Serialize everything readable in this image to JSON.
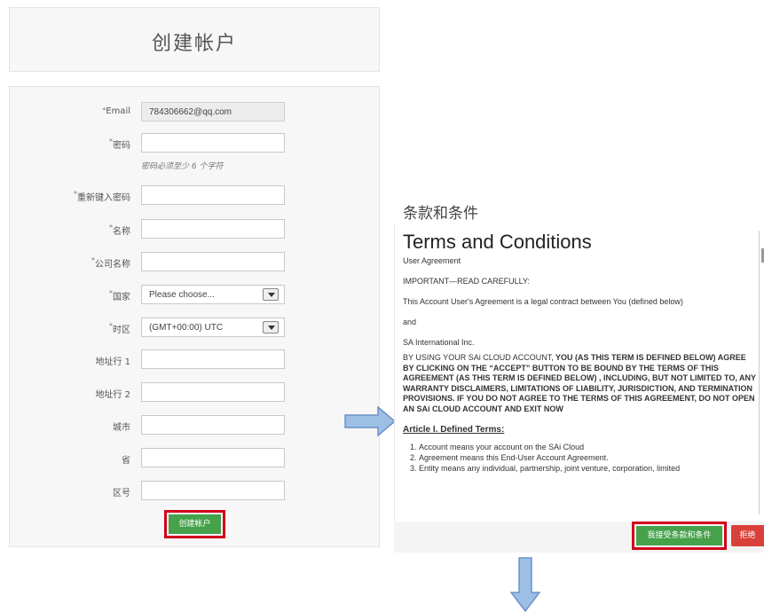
{
  "create_account": {
    "title": "创建帐户",
    "fields": [
      {
        "label": "Email",
        "value": "784306662@qq.com",
        "placeholder": ""
      },
      {
        "label": "密码",
        "value": "",
        "placeholder": ""
      },
      {
        "label": "重新键入密码",
        "value": "",
        "placeholder": ""
      },
      {
        "label": "名称",
        "value": "",
        "placeholder": ""
      },
      {
        "label": "公司名称",
        "value": "",
        "placeholder": ""
      },
      {
        "label": "国家",
        "value": "Please choose..."
      },
      {
        "label": "时区",
        "value": "(GMT+00:00) UTC"
      },
      {
        "label": "地址行 1",
        "value": ""
      },
      {
        "label": "地址行 2",
        "value": ""
      },
      {
        "label": "城市",
        "value": ""
      },
      {
        "label": "省",
        "value": ""
      },
      {
        "label": "区号",
        "value": ""
      }
    ],
    "required_mark": "*",
    "password_hint": "密码必须至少 6 个字符",
    "submit_label": "创建帐户"
  },
  "terms": {
    "heading": "条款和条件",
    "title": "Terms and Conditions",
    "p1": "User Agreement",
    "p2": "IMPORTANT—READ CAREFULLY:",
    "p3": "This Account User's Agreement is a legal contract between You (defined below)",
    "p4": "and",
    "p5": "SA International Inc.",
    "p6_lead": "BY USING YOUR SAi CLOUD ACCOUNT,",
    "p6_rest": " YOU (AS THIS TERM IS DEFINED BELOW) AGREE BY CLICKING ON THE “ACCEPT” BUTTON TO BE BOUND BY THE TERMS OF THIS AGREEMENT (AS THIS TERM IS DEFINED BELOW) , INCLUDING, BUT NOT LIMITED TO, ANY WARRANTY DISCLAIMERS, LIMITATIONS OF LIABILITY, JURISDICTION, AND TERMINATION PROVISIONS. IF YOU DO NOT AGREE TO THE TERMS OF THIS AGREEMENT, DO NOT OPEN AN SAi CLOUD ACCOUNT AND EXIT NOW",
    "article_title": "Article I. Defined Terms:",
    "list": [
      "Account means your account on the SAi Cloud",
      "Agreement means this End-User Account Agreement.",
      "Entity means any individual, partnership, joint venture, corporation, limited"
    ],
    "accept_label": "我接受条款和条件",
    "decline_label": "拒绝"
  },
  "colors": {
    "accent_green": "#45a24a",
    "highlight_red": "#d0021b",
    "arrow_blue": "#9dbfe6"
  }
}
